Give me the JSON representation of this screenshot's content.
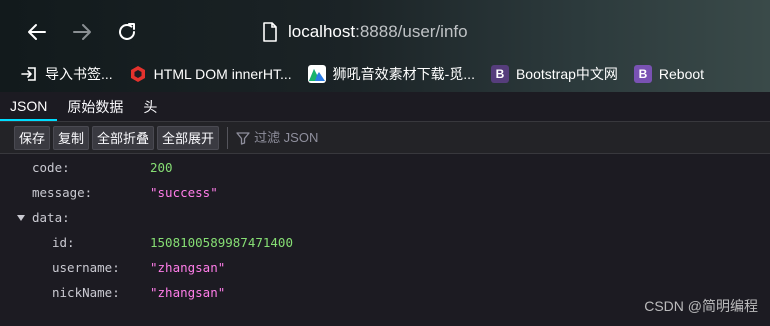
{
  "browser": {
    "url_host": "localhost",
    "url_rest": ":8888/user/info",
    "bookmarks": [
      {
        "label": "导入书签...",
        "icon": "import-icon",
        "color": "#1c1b22"
      },
      {
        "label": "HTML DOM innerHT...",
        "icon": "html-hexagon-icon",
        "color": "#e5322d"
      },
      {
        "label": "狮吼音效素材下载-觅...",
        "icon": "mountain-logo-icon",
        "color": "#2a7be4"
      },
      {
        "label": "Bootstrap中文网",
        "icon": "bootstrap-icon",
        "color": "#563d7c"
      },
      {
        "label": "Reboot",
        "icon": "bootstrap-icon",
        "color": "#7952b3"
      }
    ]
  },
  "viewer": {
    "tabs": [
      "JSON",
      "原始数据",
      "头"
    ],
    "toolbar": {
      "save": "保存",
      "copy": "复制",
      "collapse_all": "全部折叠",
      "expand_all": "全部展开",
      "filter_placeholder": "过滤 JSON"
    },
    "rows": [
      {
        "key": "code:",
        "value": "200",
        "type": "number"
      },
      {
        "key": "message:",
        "value": "\"success\"",
        "type": "string"
      },
      {
        "key": "data:",
        "value": "",
        "type": "object"
      },
      {
        "key": "id:",
        "value": "1508100589987471400",
        "type": "number"
      },
      {
        "key": "username:",
        "value": "\"zhangsan\"",
        "type": "string"
      },
      {
        "key": "nickName:",
        "value": "\"zhangsan\"",
        "type": "string"
      }
    ]
  },
  "watermark": "CSDN @简明编程"
}
